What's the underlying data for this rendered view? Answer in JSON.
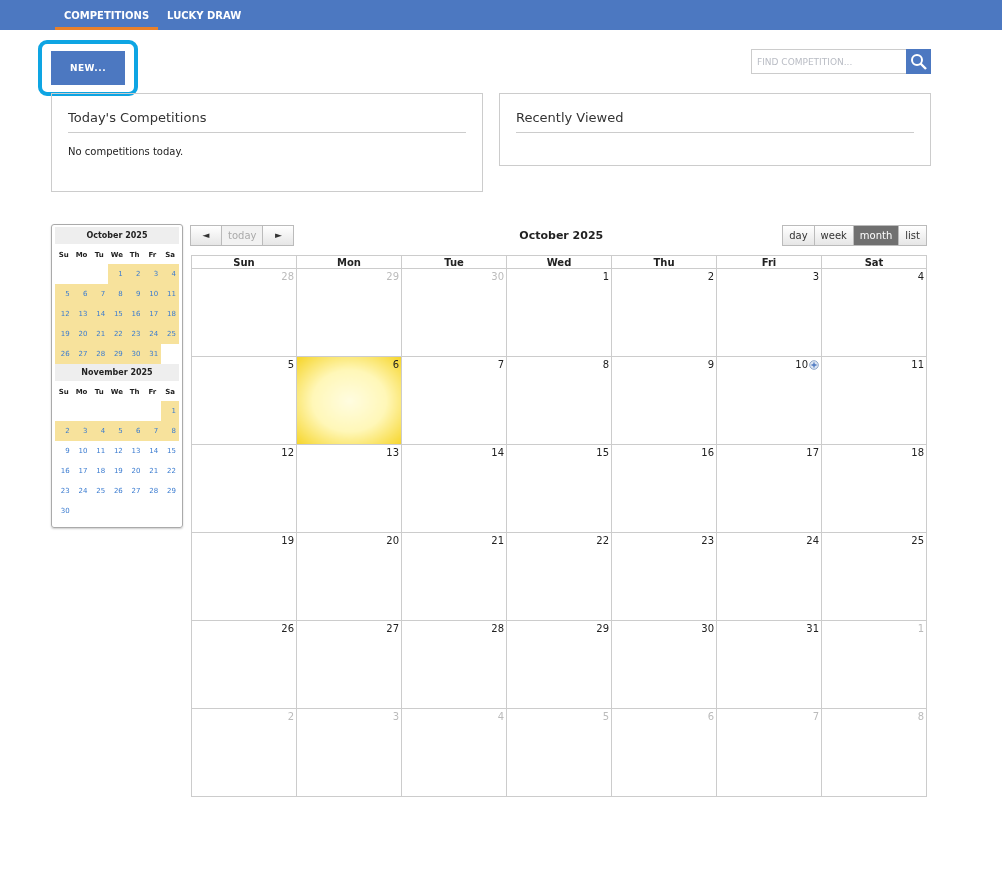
{
  "nav": {
    "tabs": [
      {
        "label": "COMPETITIONS",
        "selected": true
      },
      {
        "label": "LUCKY DRAW",
        "selected": false
      }
    ]
  },
  "toolbar": {
    "new_button": {
      "label": "NEW...",
      "highlighted": true
    },
    "search": {
      "placeholder": "FIND COMPETITION..."
    }
  },
  "panels": [
    {
      "title": "Today's Competitions",
      "text": "No competitions today."
    },
    {
      "title": "Recently Viewed"
    }
  ],
  "mini_calendars": [
    {
      "title": "October 2025",
      "weekdays": [
        "Su",
        "Mo",
        "Tu",
        "We",
        "Th",
        "Fr",
        "Sa"
      ],
      "weeks": [
        [
          {
            "kind": "blank"
          },
          {
            "kind": "blank"
          },
          {
            "kind": "blank"
          },
          {
            "day": "1",
            "highlighted": true
          },
          {
            "day": "2",
            "highlighted": true
          },
          {
            "day": "3",
            "highlighted": true
          },
          {
            "day": "4",
            "highlighted": true
          }
        ],
        [
          {
            "day": "5",
            "highlighted": true
          },
          {
            "day": "6",
            "highlighted": true
          },
          {
            "day": "7",
            "highlighted": true
          },
          {
            "day": "8",
            "highlighted": true
          },
          {
            "day": "9",
            "highlighted": true
          },
          {
            "day": "10",
            "highlighted": true
          },
          {
            "day": "11",
            "highlighted": true
          }
        ],
        [
          {
            "day": "12",
            "highlighted": true
          },
          {
            "day": "13",
            "highlighted": true
          },
          {
            "day": "14",
            "highlighted": true
          },
          {
            "day": "15",
            "highlighted": true
          },
          {
            "day": "16",
            "highlighted": true
          },
          {
            "day": "17",
            "highlighted": true
          },
          {
            "day": "18",
            "highlighted": true
          }
        ],
        [
          {
            "day": "19",
            "highlighted": true
          },
          {
            "day": "20",
            "highlighted": true
          },
          {
            "day": "21",
            "highlighted": true
          },
          {
            "day": "22",
            "highlighted": true
          },
          {
            "day": "23",
            "highlighted": true
          },
          {
            "day": "24",
            "highlighted": true
          },
          {
            "day": "25",
            "highlighted": true
          }
        ],
        [
          {
            "day": "26",
            "highlighted": true
          },
          {
            "day": "27",
            "highlighted": true
          },
          {
            "day": "28",
            "highlighted": true
          },
          {
            "day": "29",
            "highlighted": true
          },
          {
            "day": "30",
            "highlighted": true
          },
          {
            "day": "31",
            "highlighted": true
          },
          {
            "kind": "blank"
          }
        ]
      ]
    },
    {
      "title": "November 2025",
      "weekdays": [
        "Su",
        "Mo",
        "Tu",
        "We",
        "Th",
        "Fr",
        "Sa"
      ],
      "weeks": [
        [
          {
            "kind": "blank"
          },
          {
            "kind": "blank"
          },
          {
            "kind": "blank"
          },
          {
            "kind": "blank"
          },
          {
            "kind": "blank"
          },
          {
            "kind": "blank"
          },
          {
            "day": "1",
            "highlighted": true
          }
        ],
        [
          {
            "day": "2",
            "highlighted": true
          },
          {
            "day": "3",
            "highlighted": true
          },
          {
            "day": "4",
            "highlighted": true
          },
          {
            "day": "5",
            "highlighted": true
          },
          {
            "day": "6",
            "highlighted": true
          },
          {
            "day": "7",
            "highlighted": true
          },
          {
            "day": "8",
            "highlighted": true
          }
        ],
        [
          {
            "day": "9",
            "highlighted": false
          },
          {
            "day": "10",
            "highlighted": false
          },
          {
            "day": "11",
            "highlighted": false
          },
          {
            "day": "12",
            "highlighted": false
          },
          {
            "day": "13",
            "highlighted": false
          },
          {
            "day": "14",
            "highlighted": false
          },
          {
            "day": "15",
            "highlighted": false
          }
        ],
        [
          {
            "day": "16",
            "highlighted": false
          },
          {
            "day": "17",
            "highlighted": false
          },
          {
            "day": "18",
            "highlighted": false
          },
          {
            "day": "19",
            "highlighted": false
          },
          {
            "day": "20",
            "highlighted": false
          },
          {
            "day": "21",
            "highlighted": false
          },
          {
            "day": "22",
            "highlighted": false
          }
        ],
        [
          {
            "day": "23",
            "highlighted": false
          },
          {
            "day": "24",
            "highlighted": false
          },
          {
            "day": "25",
            "highlighted": false
          },
          {
            "day": "26",
            "highlighted": false
          },
          {
            "day": "27",
            "highlighted": false
          },
          {
            "day": "28",
            "highlighted": false
          },
          {
            "day": "29",
            "highlighted": false
          }
        ],
        [
          {
            "day": "30",
            "highlighted": false
          },
          {
            "kind": "blank"
          },
          {
            "kind": "blank"
          },
          {
            "kind": "blank"
          },
          {
            "kind": "blank"
          },
          {
            "kind": "blank"
          },
          {
            "kind": "blank"
          }
        ]
      ]
    }
  ],
  "calendar": {
    "prev": "◄",
    "today": {
      "label": "today",
      "disabled": true
    },
    "next": "►",
    "title": "October 2025",
    "views": [
      {
        "label": "day",
        "selected": false
      },
      {
        "label": "week",
        "selected": false
      },
      {
        "label": "month",
        "selected": true
      },
      {
        "label": "list",
        "selected": false
      }
    ],
    "weekdays": [
      "Sun",
      "Mon",
      "Tue",
      "Wed",
      "Thu",
      "Fri",
      "Sat"
    ],
    "weeks": [
      [
        {
          "day": "28",
          "other_month": true
        },
        {
          "day": "29",
          "other_month": true
        },
        {
          "day": "30",
          "other_month": true
        },
        {
          "day": "1",
          "other_month": false
        },
        {
          "day": "2",
          "other_month": false
        },
        {
          "day": "3",
          "other_month": false
        },
        {
          "day": "4",
          "other_month": false
        }
      ],
      [
        {
          "day": "5",
          "other_month": false
        },
        {
          "day": "6",
          "other_month": false,
          "today": true
        },
        {
          "day": "7",
          "other_month": false
        },
        {
          "day": "8",
          "other_month": false
        },
        {
          "day": "9",
          "other_month": false
        },
        {
          "day": "10",
          "other_month": false,
          "add_button": true
        },
        {
          "day": "11",
          "other_month": false
        }
      ],
      [
        {
          "day": "12",
          "other_month": false
        },
        {
          "day": "13",
          "other_month": false
        },
        {
          "day": "14",
          "other_month": false
        },
        {
          "day": "15",
          "other_month": false
        },
        {
          "day": "16",
          "other_month": false
        },
        {
          "day": "17",
          "other_month": false
        },
        {
          "day": "18",
          "other_month": false
        }
      ],
      [
        {
          "day": "19",
          "other_month": false
        },
        {
          "day": "20",
          "other_month": false
        },
        {
          "day": "21",
          "other_month": false
        },
        {
          "day": "22",
          "other_month": false
        },
        {
          "day": "23",
          "other_month": false
        },
        {
          "day": "24",
          "other_month": false
        },
        {
          "day": "25",
          "other_month": false
        }
      ],
      [
        {
          "day": "26",
          "other_month": false
        },
        {
          "day": "27",
          "other_month": false
        },
        {
          "day": "28",
          "other_month": false
        },
        {
          "day": "29",
          "other_month": false
        },
        {
          "day": "30",
          "other_month": false
        },
        {
          "day": "31",
          "other_month": false
        },
        {
          "day": "1",
          "other_month": true
        }
      ],
      [
        {
          "day": "2",
          "other_month": true
        },
        {
          "day": "3",
          "other_month": true
        },
        {
          "day": "4",
          "other_month": true
        },
        {
          "day": "5",
          "other_month": true
        },
        {
          "day": "6",
          "other_month": true
        },
        {
          "day": "7",
          "other_month": true
        },
        {
          "day": "8",
          "other_month": true
        }
      ]
    ]
  }
}
